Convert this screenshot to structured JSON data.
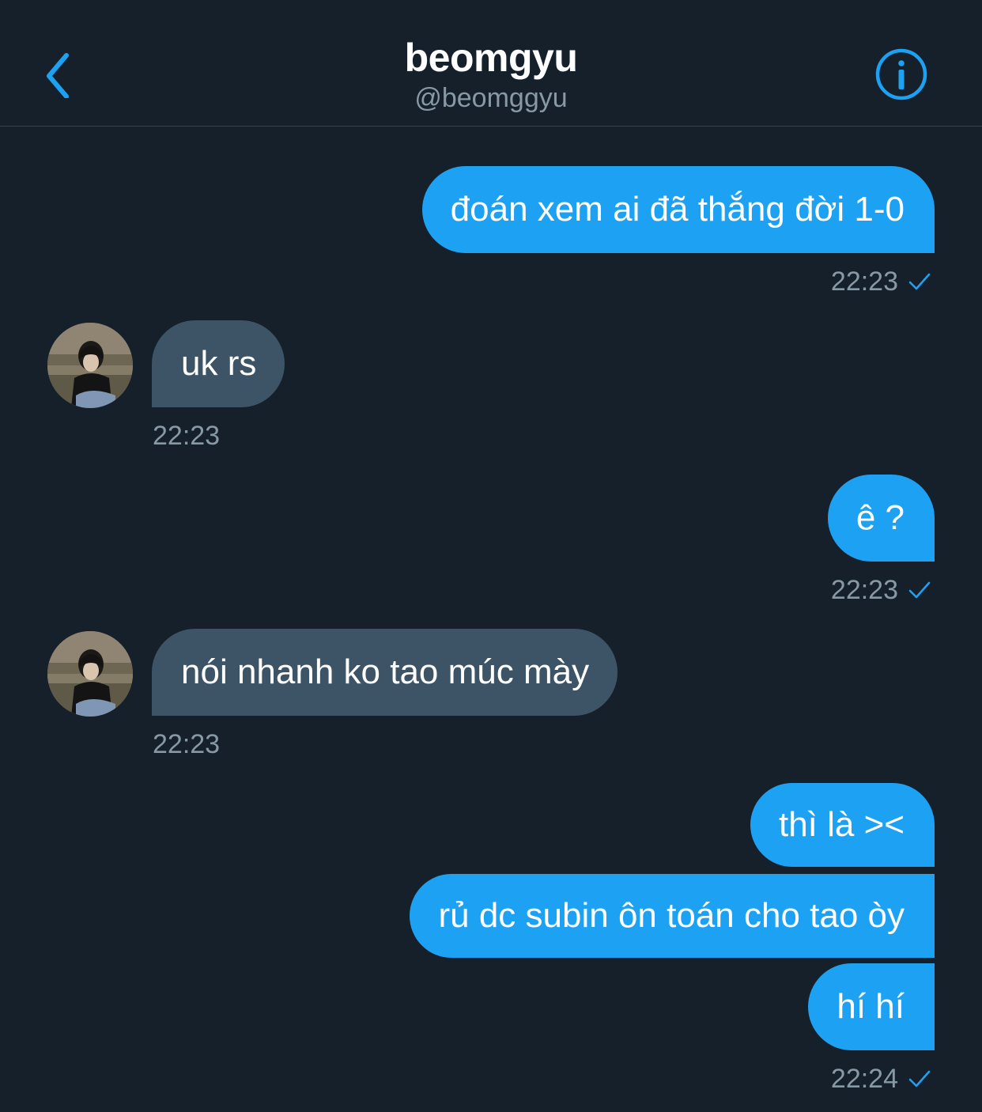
{
  "header": {
    "title": "beomgyu",
    "handle": "@beomggyu"
  },
  "messages": [
    {
      "text": "đoán xem ai đã thắng đời 1-0",
      "time": "22:23"
    },
    {
      "text": "uk rs",
      "time": "22:23"
    },
    {
      "text": "ê ?",
      "time": "22:23"
    },
    {
      "text": "nói nhanh ko tao múc mày",
      "time": "22:23"
    },
    {
      "text": "thì là ><"
    },
    {
      "text": "rủ dc subin ôn toán cho tao òy"
    },
    {
      "text": "hí hí",
      "time": "22:24"
    }
  ],
  "colors": {
    "background": "#15202b",
    "accent": "#1da1f2",
    "incoming_bubble": "#3d5466",
    "secondary_text": "#8899a6"
  },
  "icons": {
    "back": "chevron-left-icon",
    "info": "info-circle-icon",
    "read": "checkmark-icon"
  }
}
